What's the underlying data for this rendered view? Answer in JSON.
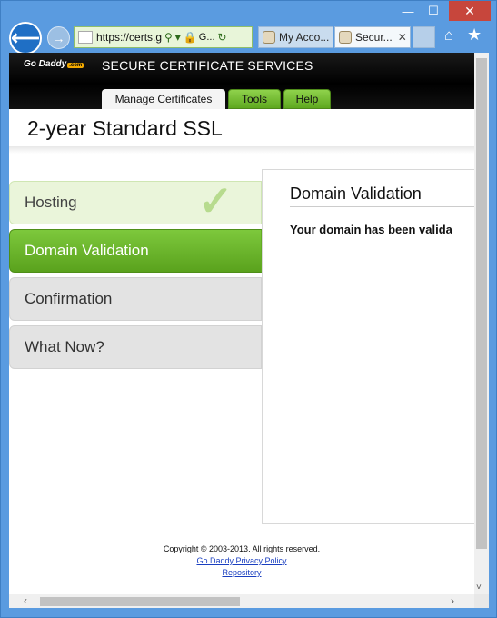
{
  "browser": {
    "window_controls": {
      "minimize": "—",
      "maximize": "☐",
      "close": "✕"
    },
    "back_glyph": "⟵",
    "forward_glyph": "→",
    "address": {
      "url": "https://certs.g",
      "search_glyph": "⚲",
      "dropdown_glyph": "▾",
      "lock_glyph": "🔒",
      "cert_label": "G...",
      "refresh_glyph": "↻"
    },
    "tabs": [
      {
        "label": "My Acco...",
        "active": false
      },
      {
        "label": "Secur...",
        "active": true,
        "close_glyph": "✕"
      }
    ],
    "home_glyph": "⌂",
    "favorites_glyph": "★"
  },
  "site": {
    "logo_text": "Go Daddy",
    "logo_badge": ".com",
    "title": "SECURE CERTIFICATE SERVICES",
    "nav": {
      "manage": "Manage Certificates",
      "tools": "Tools",
      "help": "Help"
    }
  },
  "page": {
    "title": "2-year Standard SSL",
    "steps": [
      {
        "label": "Hosting",
        "state": "completed"
      },
      {
        "label": "Domain Validation",
        "state": "current"
      },
      {
        "label": "Confirmation",
        "state": "pending"
      },
      {
        "label": "What Now?",
        "state": "pending"
      }
    ],
    "check_glyph": "✓",
    "panel": {
      "title": "Domain Validation",
      "message": "Your domain has been valida"
    }
  },
  "footer": {
    "copyright": "Copyright © 2003-2013. All rights reserved.",
    "privacy_link": "Go Daddy Privacy Policy",
    "repository_link": "Repository"
  },
  "scroll": {
    "up": "˄",
    "down": "˅",
    "left": "‹",
    "right": "›"
  },
  "colors": {
    "accent_green": "#6bb52b",
    "frame_blue": "#5a9be0",
    "back_blue": "#1f6fc5"
  }
}
